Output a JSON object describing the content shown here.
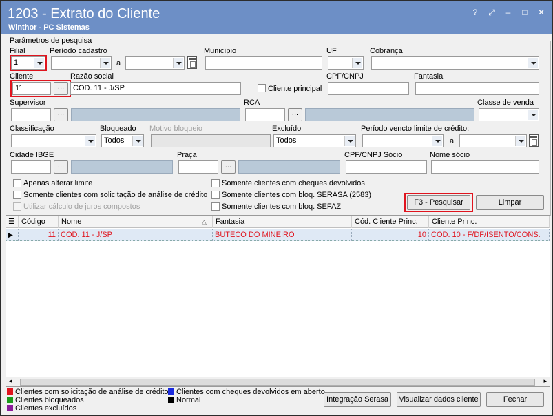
{
  "window": {
    "title": "1203 - Extrato do Cliente",
    "subtitle": "Winthor - PC Sistemas",
    "controls": [
      "?",
      "⤢",
      "–",
      "□",
      "✕"
    ]
  },
  "params": {
    "group_title": "Parâmetros de pesquisa",
    "filial_label": "Filial",
    "filial_value": "1",
    "periodo_cadastro_label": "Período cadastro",
    "a_label": "a",
    "municipio_label": "Município",
    "uf_label": "UF",
    "cobranca_label": "Cobrança",
    "cliente_label": "Cliente",
    "cliente_value": "11",
    "razao_label": "Razão social",
    "razao_value": "COD. 11 - J/SP",
    "cliente_principal_label": "Cliente principal",
    "cpf_label": "CPF/CNPJ",
    "fantasia_label": "Fantasia",
    "supervisor_label": "Supervisor",
    "rca_label": "RCA",
    "classe_label": "Classe de venda",
    "classificacao_label": "Classificação",
    "bloqueado_label": "Bloqueado",
    "bloqueado_value": "Todos",
    "motivo_label": "Motivo bloqueio",
    "excluido_label": "Excluído",
    "excluido_value": "Todos",
    "periodo_vencto_label": "Período vencto limite de crédito:",
    "a2_label": "à",
    "cidade_label": "Cidade IBGE",
    "praca_label": "Praça",
    "cpf_socio_label": "CPF/CNPJ Sócio",
    "nome_socio_label": "Nome sócio",
    "ellipsis": "...",
    "chk_alterar": "Apenas alterar limite",
    "chk_solicitacao": "Somente clientes com solicitação de análise de crédito",
    "chk_juros": "Utilizar cálculo de juros compostos",
    "chk_cheques": "Somente clientes com cheques devolvidos",
    "chk_serasa": "Somente clientes com bloq. SERASA (2583)",
    "chk_sefaz": "Somente clientes com bloq. SEFAZ",
    "btn_pesquisar": "F3 - Pesquisar",
    "btn_limpar": "Limpar"
  },
  "grid": {
    "columns": [
      "Código",
      "Nome",
      "Fantasia",
      "Cód. Cliente Princ.",
      "Cliente Princ."
    ],
    "rows": [
      {
        "codigo": "11",
        "nome": "COD. 11 - J/SP",
        "fantasia": "BUTECO DO MINEIRO",
        "cod_princ": "10",
        "cliente_princ": "COD. 10 - F/DF/ISENTO/CONS."
      }
    ]
  },
  "legend": {
    "items": [
      {
        "label": "Clientes com solicitação de análise de crédito",
        "color": "#e0141e"
      },
      {
        "label": "Clientes bloqueados",
        "color": "#1a9a1a"
      },
      {
        "label": "Clientes excluídos",
        "color": "#8a1a9a"
      },
      {
        "label": "Clientes com cheques devolvidos em aberto",
        "color": "#1a2adf"
      },
      {
        "label": "Normal",
        "color": "#000000"
      }
    ]
  },
  "footer": {
    "btn_serasa": "Integração Serasa",
    "btn_visualizar": "Visualizar dados cliente",
    "btn_fechar": "Fechar"
  }
}
